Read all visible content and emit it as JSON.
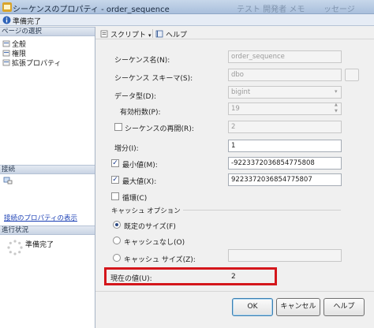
{
  "window": {
    "title": "シーケンスのプロパティ - order_sequence",
    "title_ghost": "テスト 開発者 メモ",
    "title_ghost2": "ッセージ"
  },
  "status": {
    "text": "準備完了"
  },
  "left": {
    "select_page_header": "ページの選択",
    "pages": [
      "全般",
      "権限",
      "拡張プロパティ"
    ],
    "connection_header": "接続",
    "connection_link": "接続のプロパティの表示",
    "progress_header": "進行状況",
    "progress_text": "準備完了"
  },
  "toolbar": {
    "script_label": "スクリプト",
    "help_label": "ヘルプ"
  },
  "form": {
    "sequence_name_label": "シーケンス名(N):",
    "sequence_name_value": "order_sequence",
    "schema_label": "シーケンス スキーマ(S):",
    "schema_value": "dbo",
    "data_type_label": "データ型(D):",
    "data_type_value": "bigint",
    "precision_label": "有効桁数(P):",
    "precision_value": "19",
    "restart_label": "シーケンスの再開(R):",
    "restart_checked": false,
    "restart_value": "2",
    "increment_label": "増分(I):",
    "increment_value": "1",
    "min_label": "最小値(M):",
    "min_checked": true,
    "min_value": "-9223372036854775808",
    "max_label": "最大値(X):",
    "max_checked": true,
    "max_value": "9223372036854775807",
    "cycle_label": "循環(C)",
    "cycle_checked": false,
    "cache_group_label": "キャッシュ オプション",
    "cache_default_label": "既定のサイズ(F)",
    "cache_none_label": "キャッシュなし(O)",
    "cache_size_label": "キャッシュ サイズ(Z):",
    "cache_selected": "default",
    "cache_size_value": "",
    "current_value_label": "現在の値(U):",
    "current_value": "2"
  },
  "buttons": {
    "ok": "OK",
    "cancel": "キャンセル",
    "help": "ヘルプ"
  },
  "colors": {
    "highlight_border": "#d4161b",
    "link": "#1a3fb5"
  }
}
